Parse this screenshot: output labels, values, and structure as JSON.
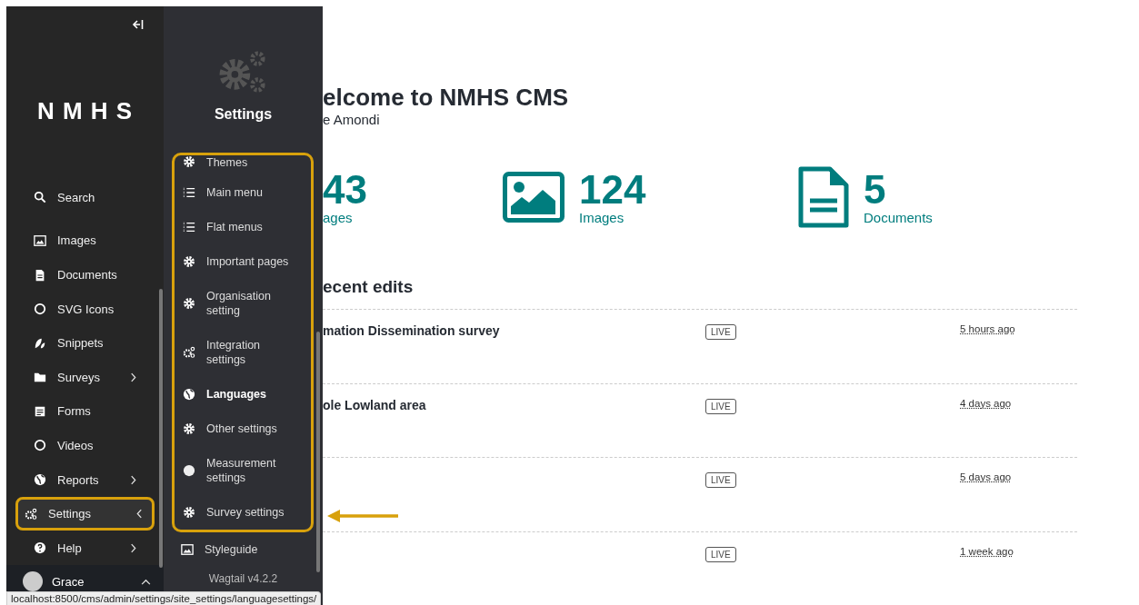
{
  "sidebar": {
    "logo": "N M H S",
    "items": [
      {
        "label": "Search",
        "kind": "search",
        "selected": false,
        "highlighted": false
      },
      {
        "label": "Images",
        "kind": "image",
        "selected": false,
        "highlighted": false
      },
      {
        "label": "Documents",
        "kind": "doc",
        "selected": false,
        "highlighted": false
      },
      {
        "label": "SVG Icons",
        "kind": "ring",
        "selected": false,
        "highlighted": false
      },
      {
        "label": "Snippets",
        "kind": "leaf",
        "selected": false,
        "highlighted": false
      },
      {
        "label": "Surveys",
        "kind": "folder",
        "expanded": false,
        "selected": false,
        "highlighted": false
      },
      {
        "label": "Forms",
        "kind": "form",
        "selected": false,
        "highlighted": false
      },
      {
        "label": "Videos",
        "kind": "ring",
        "selected": false,
        "highlighted": false
      },
      {
        "label": "Reports",
        "kind": "globe",
        "expanded": false,
        "selected": false,
        "highlighted": false
      },
      {
        "label": "Settings",
        "kind": "gears",
        "expanded": true,
        "selected": true,
        "highlighted": true
      },
      {
        "label": "Help",
        "kind": "help",
        "expanded": false,
        "selected": false,
        "highlighted": false
      }
    ],
    "user": {
      "name": "Grace"
    }
  },
  "flyout": {
    "title": "Settings",
    "highlighted_items": [
      {
        "label": "Themes",
        "kind": "gear",
        "selected": false
      },
      {
        "label": "Main menu",
        "kind": "list",
        "selected": false
      },
      {
        "label": "Flat menus",
        "kind": "list",
        "selected": false
      },
      {
        "label": "Important pages",
        "kind": "gear",
        "selected": false
      },
      {
        "label": "Organisation setting",
        "kind": "gear",
        "selected": false
      },
      {
        "label": "Integration settings",
        "kind": "gears",
        "selected": false
      },
      {
        "label": "Languages",
        "kind": "globe",
        "selected": true
      },
      {
        "label": "Other settings",
        "kind": "gear",
        "selected": false
      },
      {
        "label": "Measurement settings",
        "kind": "dot",
        "selected": false
      },
      {
        "label": "Survey settings",
        "kind": "gear",
        "selected": false
      }
    ],
    "items": [
      {
        "label": "Styleguide",
        "kind": "image",
        "selected": false
      }
    ],
    "version": "Wagtail v4.2.2"
  },
  "main": {
    "heading": "elcome to NMHS CMS",
    "subtitle": "e Amondi",
    "stats": [
      {
        "kind": "pages",
        "count": "43",
        "label": "ages"
      },
      {
        "kind": "image",
        "count": "124",
        "label": "Images"
      },
      {
        "kind": "document",
        "count": "5",
        "label": "Documents"
      }
    ],
    "recent_heading": "ecent edits",
    "rows": [
      {
        "title": "mation Dissemination survey",
        "status": "LIVE",
        "time": "5 hours ago"
      },
      {
        "title": "ole Lowland area",
        "status": "LIVE",
        "time": "4 days ago"
      },
      {
        "status": "LIVE",
        "time": "5 days ago"
      },
      {
        "status": "LIVE",
        "time": "1 week ago"
      }
    ]
  },
  "status_bar": {
    "url": "localhost:8500/cms/admin/settings/site_settings/languagesettings/"
  }
}
